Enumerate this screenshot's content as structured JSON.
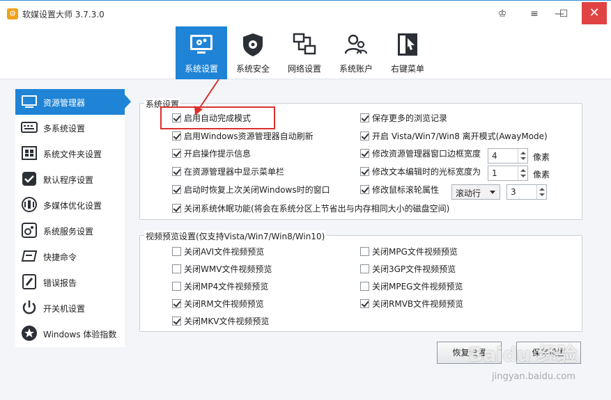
{
  "window": {
    "title": "软媒设置大师 3.7.3.0",
    "controls": {
      "skin": "♔",
      "menu": "≡",
      "minimize": "—",
      "maximize": "☐",
      "close": "✕"
    }
  },
  "toolbar": {
    "tabs": [
      {
        "label": "系统设置",
        "active": true
      },
      {
        "label": "系统安全",
        "active": false
      },
      {
        "label": "网络设置",
        "active": false
      },
      {
        "label": "系统账户",
        "active": false
      },
      {
        "label": "右键菜单",
        "active": false
      }
    ]
  },
  "sidebar": {
    "items": [
      {
        "label": "资源管理器",
        "active": true
      },
      {
        "label": "多系统设置"
      },
      {
        "label": "系统文件夹设置"
      },
      {
        "label": "默认程序设置"
      },
      {
        "label": "多媒体优化设置"
      },
      {
        "label": "系统服务设置"
      },
      {
        "label": "快捷命令"
      },
      {
        "label": "错误报告"
      },
      {
        "label": "开关机设置"
      },
      {
        "label": "Windows 体验指数"
      }
    ]
  },
  "system_settings": {
    "title": "系统设置",
    "left": [
      {
        "label": "启用自动完成模式",
        "checked": true
      },
      {
        "label": "启用Windows资源管理器自动刷新",
        "checked": true
      },
      {
        "label": "开启操作提示信息",
        "checked": true
      },
      {
        "label": "在资源管理器中显示菜单栏",
        "checked": true
      },
      {
        "label": "启动时恢复上次关闭Windows时的窗口",
        "checked": true
      }
    ],
    "right": [
      {
        "label": "保存更多的浏览记录",
        "checked": true
      },
      {
        "label": "开启 Vista/Win7/Win8 离开模式(AwayMode)",
        "checked": true
      },
      {
        "label": "修改资源管理器窗口边框宽度",
        "checked": true
      },
      {
        "label": "修改文本编辑时的光标宽度为",
        "checked": true
      },
      {
        "label": "修改鼠标滚轮属性",
        "checked": true
      }
    ],
    "border_width": {
      "value": "4",
      "unit": "像素"
    },
    "cursor_width": {
      "value": "1",
      "unit": "像素"
    },
    "wheel": {
      "mode": "滚动行",
      "value": "3"
    },
    "hibernate": {
      "label": "关闭系统休眠功能(将会在系统分区上节省出与内存相同大小的磁盘空间)",
      "checked": true
    }
  },
  "video_preview": {
    "title": "视频预览设置(仅支持Vista/Win7/Win8/Win10)",
    "left": [
      {
        "label": "关闭AVI文件视频预览",
        "checked": false
      },
      {
        "label": "关闭WMV文件视频预览",
        "checked": false
      },
      {
        "label": "关闭MP4文件视频预览",
        "checked": false
      },
      {
        "label": "关闭RM文件视频预览",
        "checked": true
      },
      {
        "label": "关闭MKV文件视频预览",
        "checked": true
      }
    ],
    "right": [
      {
        "label": "关闭MPG文件视频预览",
        "checked": false
      },
      {
        "label": "关闭3GP文件视频预览",
        "checked": false
      },
      {
        "label": "关闭MPEG文件视频预览",
        "checked": false
      },
      {
        "label": "关闭RMVB文件视频预览",
        "checked": true
      }
    ]
  },
  "buttons": {
    "restore": "恢复设置",
    "save": "保存设置"
  },
  "watermark": {
    "brand": "Baidu 经验",
    "url": "jingyan.baidu.com"
  },
  "colors": {
    "accent": "#1f84d6",
    "highlight": "#d9302c"
  }
}
